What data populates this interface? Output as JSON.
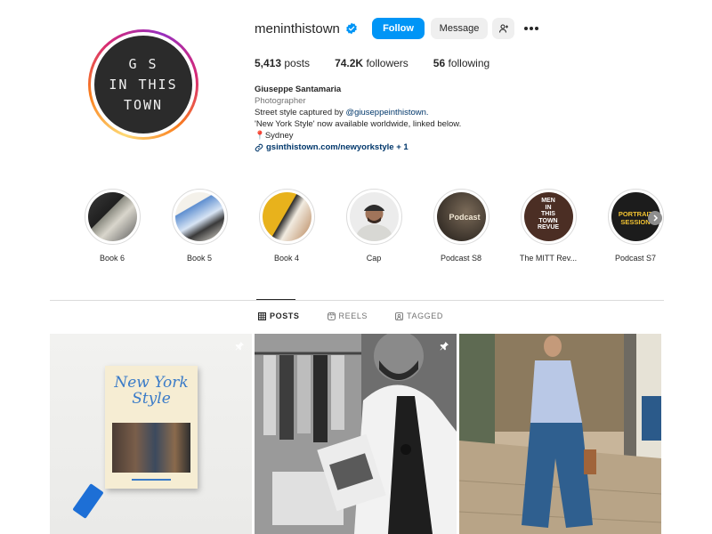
{
  "profile": {
    "avatar_lines": [
      "G S",
      "IN THIS",
      "TOWN"
    ],
    "username": "meninthistown",
    "follow_label": "Follow",
    "message_label": "Message",
    "stats": [
      {
        "value": "5,413",
        "label": "posts"
      },
      {
        "value": "74.2K",
        "label": "followers"
      },
      {
        "value": "56",
        "label": "following"
      }
    ],
    "bio": {
      "name": "Giuseppe Santamaria",
      "category": "Photographer",
      "line1_prefix": "Street style captured by ",
      "line1_mention": "@giuseppeinthistown.",
      "line2": "'New York Style' now available worldwide, linked below.",
      "line3": "📍Sydney",
      "link": "gsinthistown.com/newyorkstyle + 1"
    }
  },
  "highlights": [
    {
      "label": "Book 6",
      "icon": "book-stack"
    },
    {
      "label": "Book 5",
      "icon": "book-cover-blue"
    },
    {
      "label": "Book 4",
      "icon": "book-yellow"
    },
    {
      "label": "Cap",
      "icon": "portrait-cap"
    },
    {
      "label": "Podcast S8",
      "icon": "microphone"
    },
    {
      "label": "The MITT Rev...",
      "icon": "men-in-this-town-revue"
    },
    {
      "label": "Podcast S7",
      "icon": "portrait-session"
    }
  ],
  "highlight_texts": {
    "podcast_s8": "Podcast",
    "mitt_revue": [
      "MEN",
      "IN",
      "THIS",
      "TOWN",
      "REVUE"
    ],
    "portrait_session": [
      "PORTRAIT",
      "SESSION"
    ]
  },
  "tabs": [
    {
      "label": "POSTS",
      "active": true,
      "icon": "grid-icon"
    },
    {
      "label": "REELS",
      "active": false,
      "icon": "reels-icon"
    },
    {
      "label": "TAGGED",
      "active": false,
      "icon": "tagged-icon"
    }
  ],
  "posts": {
    "book_title_line1": "New York",
    "book_title_line2": "Style"
  },
  "colors": {
    "follow_button": "#0095f6",
    "verified_badge": "#0095f6",
    "link": "#00376b",
    "secondary_text": "#737373"
  }
}
